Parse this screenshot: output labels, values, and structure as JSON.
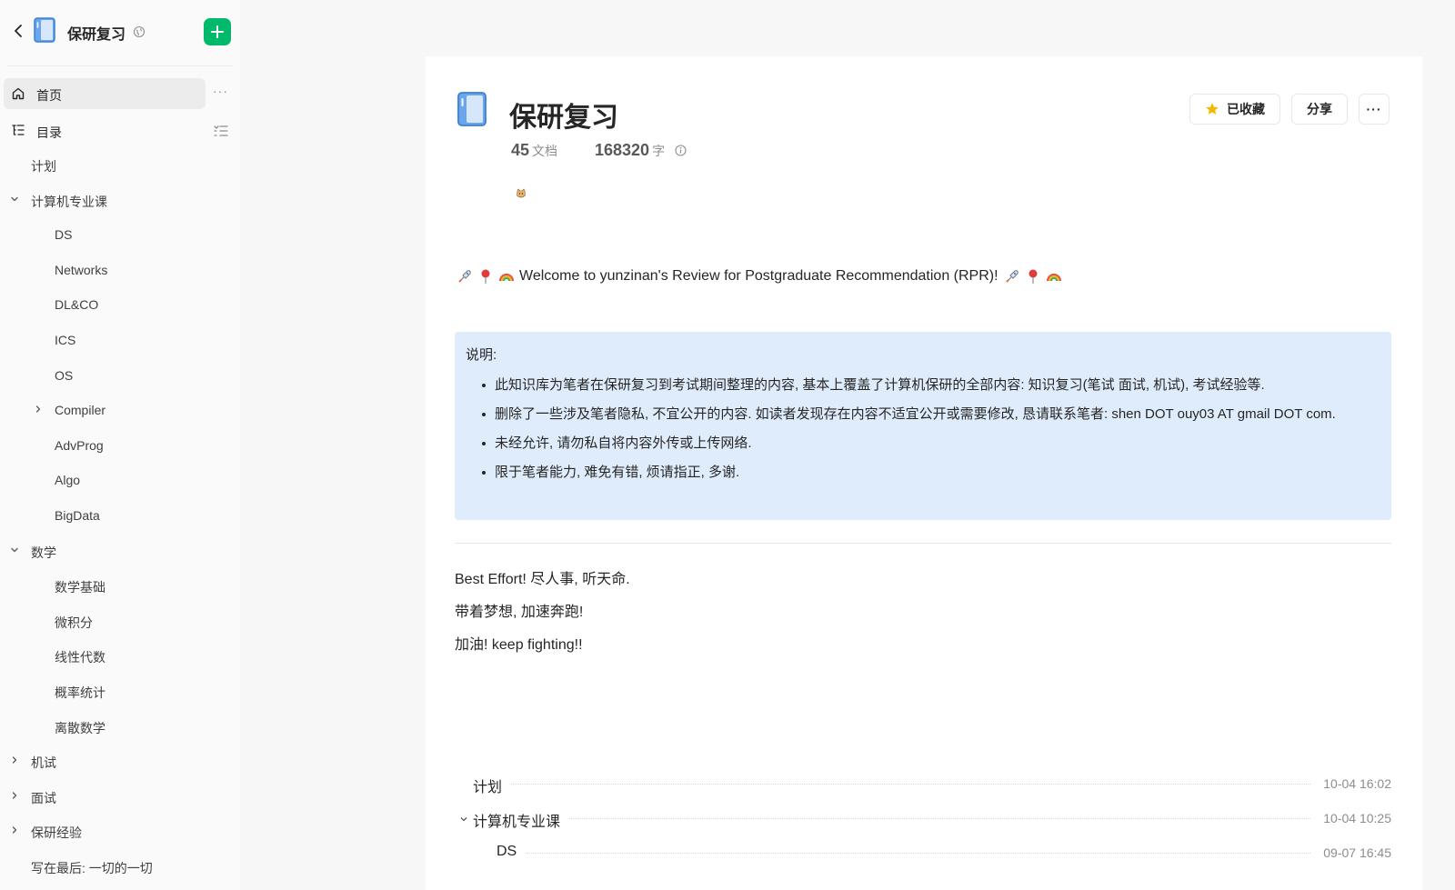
{
  "sidebar": {
    "book_title": "保研复习",
    "nav": {
      "home": "首页",
      "toc": "目录",
      "more": "···"
    },
    "tree": [
      {
        "label": "计划",
        "level": 0,
        "caret": "none"
      },
      {
        "label": "计算机专业课",
        "level": 0,
        "caret": "down"
      },
      {
        "label": "DS",
        "level": 1,
        "caret": "none"
      },
      {
        "label": "Networks",
        "level": 1,
        "caret": "none"
      },
      {
        "label": "DL&CO",
        "level": 1,
        "caret": "none"
      },
      {
        "label": "ICS",
        "level": 1,
        "caret": "none"
      },
      {
        "label": "OS",
        "level": 1,
        "caret": "none"
      },
      {
        "label": "Compiler",
        "level": 1,
        "caret": "right"
      },
      {
        "label": "AdvProg",
        "level": 1,
        "caret": "none"
      },
      {
        "label": "Algo",
        "level": 1,
        "caret": "none"
      },
      {
        "label": "BigData",
        "level": 1,
        "caret": "none"
      },
      {
        "label": "数学",
        "level": 0,
        "caret": "down"
      },
      {
        "label": "数学基础",
        "level": 1,
        "caret": "none"
      },
      {
        "label": "微积分",
        "level": 1,
        "caret": "none"
      },
      {
        "label": "线性代数",
        "level": 1,
        "caret": "none"
      },
      {
        "label": "概率统计",
        "level": 1,
        "caret": "none"
      },
      {
        "label": "离散数学",
        "level": 1,
        "caret": "none"
      },
      {
        "label": "机试",
        "level": 0,
        "caret": "right"
      },
      {
        "label": "面试",
        "level": 0,
        "caret": "right"
      },
      {
        "label": "保研经验",
        "level": 0,
        "caret": "right"
      },
      {
        "label": "写在最后: 一切的一切",
        "level": 0,
        "caret": "none"
      }
    ]
  },
  "main": {
    "title": "保研复习",
    "stats": {
      "docs_count": "45",
      "docs_unit": "文档",
      "words_count": "168320",
      "words_unit": "字"
    },
    "buttons": {
      "favorited": "已收藏",
      "share": "分享",
      "more": "···"
    },
    "welcome": "Welcome to yunzinan's Review for Postgraduate Recommendation (RPR)!",
    "callout": {
      "title": "说明:",
      "items": [
        "此知识库为笔者在保研复习到考试期间整理的内容, 基本上覆盖了计算机保研的全部内容: 知识复习(笔试 面试, 机试), 考试经验等.",
        "删除了一些涉及笔者隐私, 不宜公开的内容. 如读者发现存在内容不适宜公开或需要修改, 恳请联系笔者: shen DOT ouy03 AT gmail DOT com.",
        "未经允许, 请勿私自将内容外传或上传网络.",
        "限于笔者能力, 难免有错, 烦请指正, 多谢."
      ]
    },
    "paragraphs": [
      "Best Effort! 尽人事, 听天命.",
      "带着梦想, 加速奔跑!",
      "加油! keep fighting!!"
    ],
    "toc": [
      {
        "label": "计划",
        "date": "10-04 16:02",
        "level": 0,
        "caret": "none"
      },
      {
        "label": "计算机专业课",
        "date": "10-04 10:25",
        "level": 0,
        "caret": "down"
      },
      {
        "label": "DS",
        "date": "09-07 16:45",
        "level": 1,
        "caret": "none"
      }
    ]
  },
  "colors": {
    "accent_green": "#00b96b",
    "callout_bg": "#dfecfc",
    "book_blue": "#4a90e2",
    "star_yellow": "#f5b800"
  }
}
